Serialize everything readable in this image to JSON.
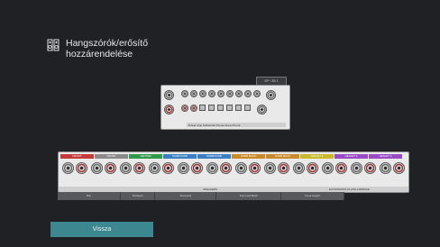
{
  "screen": {
    "title": "Hangszórók/erősítő\nhozzárendelése",
    "title_icon": "speaker-pair-icon",
    "background_color": "#1f2124"
  },
  "diagram": {
    "preout_tag": "SP * ZB 1",
    "amp_caption": "Power amp  Subwoofer Preout  Zone Preout",
    "speaker_labels": [
      {
        "text": "FRONT",
        "color": "#c43a3a"
      },
      {
        "text": "FRONT",
        "color": "#8a8a8a"
      },
      {
        "text": "CENTER",
        "color": "#2f9a4a"
      },
      {
        "text": "SURROUND",
        "color": "#3a7fc4"
      },
      {
        "text": "SURROUND",
        "color": "#3a7fc4"
      },
      {
        "text": "SURR BACK",
        "color": "#c98a2a"
      },
      {
        "text": "SURR BACK",
        "color": "#c98a2a"
      },
      {
        "text": "HEIGHT 1",
        "color": "#c8b82a"
      },
      {
        "text": "HEIGHT 2",
        "color": "#9a4ac4"
      },
      {
        "text": "HEIGHT 3",
        "color": "#9a4ac4"
      }
    ],
    "spk_caption_left": "SPEAKERS",
    "spk_caption_right": "EXTENSIONS   CLASS A BRIDGE",
    "assign_cells": [
      "Bal",
      "Középső",
      "Surround",
      "Surround Back",
      "Front Height"
    ],
    "accent_color": "#3d8790"
  },
  "footer": {
    "back_label": "Vissza"
  }
}
